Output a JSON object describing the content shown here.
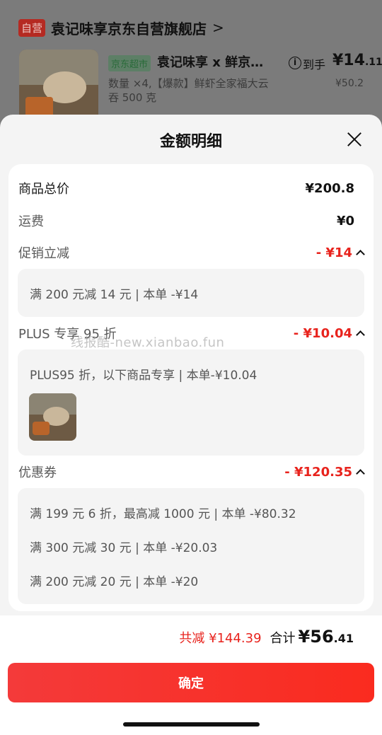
{
  "background": {
    "store_badge": "自营",
    "store_name": "袁记味享京东自营旗舰店",
    "store_chevron": ">",
    "product": {
      "tag": "京东超市",
      "title": "袁记味享 x 鲜京…",
      "price_label": "到手",
      "price_main": "¥14",
      "price_dec": ".11",
      "original_price": "¥50.2",
      "description": "数量 ×4,【爆款】鲜虾全家福大云吞 500 克",
      "info_icon": "i"
    }
  },
  "sheet": {
    "title": "金额明细",
    "rows": {
      "total": {
        "label": "商品总价",
        "value": "¥200.8"
      },
      "shipping": {
        "label": "运费",
        "value": "¥0"
      },
      "promo": {
        "label": "促销立减",
        "value": "- ¥14",
        "detail": "满 200 元减 14 元 | 本单 -¥14"
      },
      "plus": {
        "label": "PLUS 专享 95 折",
        "value": "- ¥10.04",
        "detail": "PLUS95 折，以下商品专享 | 本单-¥10.04"
      },
      "coupon": {
        "label": "优惠券",
        "value": "- ¥120.35",
        "details": [
          "满 199 元 6 折，最高减 1000 元 | 本单 -¥80.32",
          "满 300 元减 30 元 | 本单 -¥20.03",
          "满 200 元减 20 元 | 本单 -¥20"
        ]
      }
    },
    "watermark": "线报酷-new.xianbao.fun"
  },
  "footer": {
    "saved_label": "共减 ¥144.39",
    "sum_label": "合计",
    "sum_main": "¥56",
    "sum_dec": ".41",
    "confirm": "确定"
  },
  "colors": {
    "accent_red": "#e8231d",
    "button_red": "#fa2b1f"
  }
}
